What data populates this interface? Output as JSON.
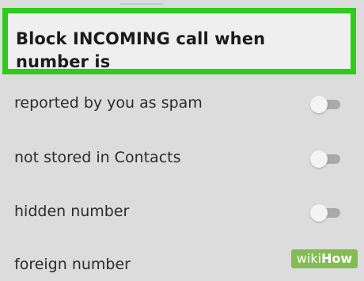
{
  "header": {
    "title": "Block INCOMING call when number is"
  },
  "options": [
    {
      "label": "reported by you as spam",
      "toggle_state": "off"
    },
    {
      "label": "not stored in Contacts",
      "toggle_state": "off"
    },
    {
      "label": "hidden number",
      "toggle_state": "off"
    },
    {
      "label": "foreign number",
      "toggle_state": "off"
    }
  ],
  "watermark": {
    "text_a": "wiki",
    "text_b": "How"
  },
  "colors": {
    "highlight": "#2ecc1a",
    "background": "#dcdcdc",
    "toggle_track": "#a9a9a9",
    "toggle_thumb": "#f4f4f4"
  }
}
